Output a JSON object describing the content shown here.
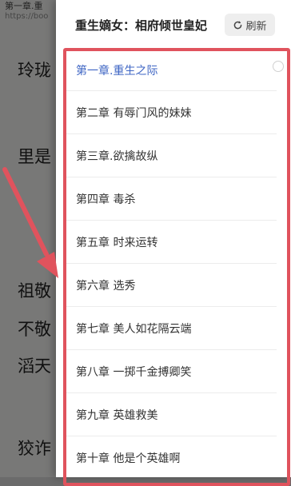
{
  "reader": {
    "header": "第一章.重",
    "url": "https://boo",
    "lines": [
      "玲珑",
      "里是",
      "祖敬",
      "不敬",
      "滔天",
      "狡诈"
    ]
  },
  "drawer": {
    "title": "重生嫡女：相府倾世皇妃",
    "refresh_label": "刷新",
    "refresh_icon": "refresh-icon"
  },
  "toc": {
    "active_index": 0,
    "chapters": [
      "第一章.重生之际",
      "第二章 有辱门风的妹妹",
      "第三章.欲擒故纵",
      "第四章 毒杀",
      "第五章 时来运转",
      "第六章 选秀",
      "第七章 美人如花隔云端",
      "第八章 一掷千金搏卿笑",
      "第九章 英雄救美",
      "第十章 他是个英雄啊"
    ]
  },
  "colors": {
    "annotation": "#e0535d",
    "active_chapter": "#3f66c4",
    "overlay": "rgba(0,0,0,0.5)"
  }
}
